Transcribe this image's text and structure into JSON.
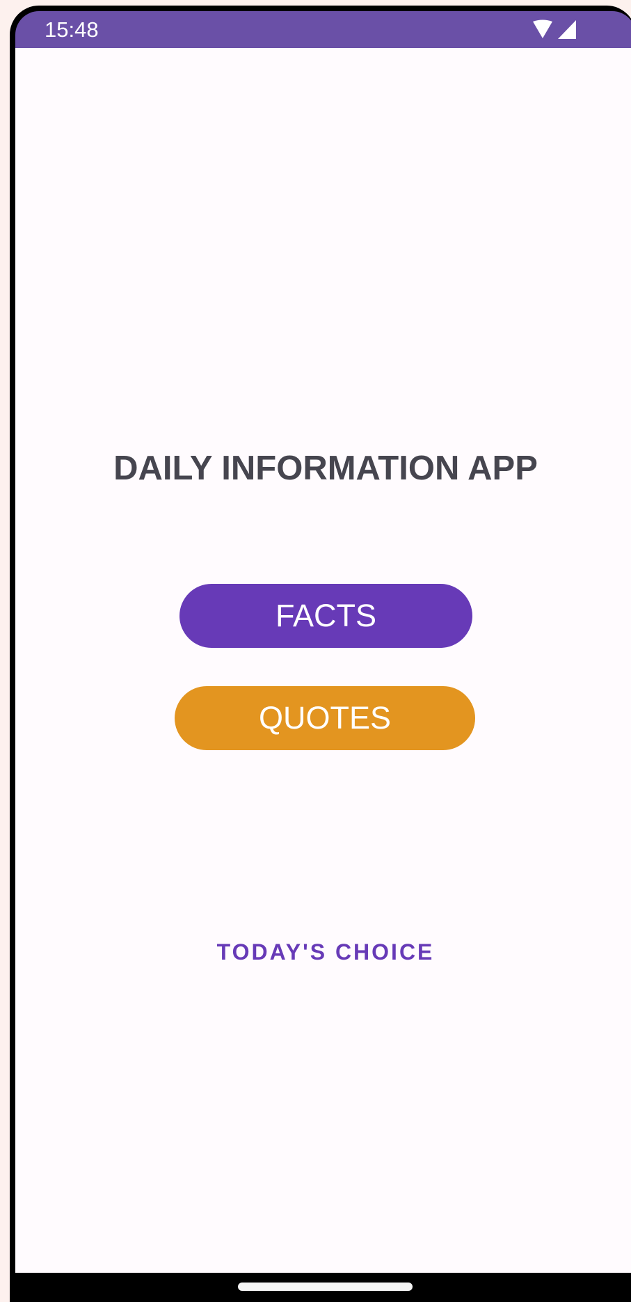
{
  "status_bar": {
    "time": "15:48",
    "icons": [
      "wifi-icon",
      "cellular-signal-icon"
    ],
    "color": "#6a50a7"
  },
  "main": {
    "title": "DAILY INFORMATION APP",
    "facts_button": {
      "label": "FACTS",
      "color": "#673ab7"
    },
    "quotes_button": {
      "label": "QUOTES",
      "color": "#e39520"
    },
    "choice_link": {
      "label": "TODAY'S CHOICE",
      "color": "#673ab7"
    }
  },
  "navigation": {
    "home_indicator": "home-gesture-bar-icon"
  }
}
